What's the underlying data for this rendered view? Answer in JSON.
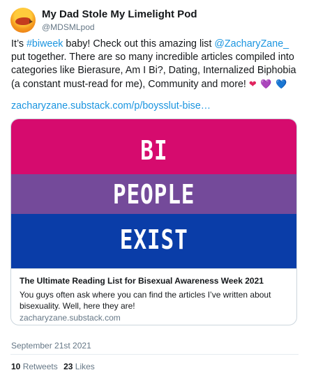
{
  "author": {
    "display_name": "My Dad Stole My Limelight Pod",
    "handle": "@MDSMLpod"
  },
  "tweet": {
    "text_1": "It’s ",
    "hashtag": "#biweek",
    "text_2": " baby! Check out this amazing list ",
    "mention": "@ZacharyZane_",
    "text_3": " put together. There are so many incredible articles compiled into categories like Bierasure, Am I Bi?, Dating, Internalized Biphobia (a constant must-read for me), Community and more! ",
    "heart_1": "❤",
    "heart_2": "💜",
    "heart_3": "💙",
    "url": "zacharyzane.substack.com/p/boysslut-bise…"
  },
  "card": {
    "flag_words": [
      "BI",
      "PEOPLE",
      "EXIST"
    ],
    "title": "The Ultimate Reading List for Bisexual Awareness Week 2021",
    "description": "You guys often ask where you can find the articles I’ve written about bisexuality. Well, here they are!",
    "domain": "zacharyzane.substack.com"
  },
  "timestamp": "September 21st 2021",
  "stats": {
    "retweets_count": "10",
    "retweets_label": "Retweets",
    "likes_count": "23",
    "likes_label": "Likes"
  },
  "colors": {
    "link": "#1b95e0",
    "flag_pink": "#d60b6e",
    "flag_purple": "#744a9a",
    "flag_blue": "#0a3da8"
  }
}
